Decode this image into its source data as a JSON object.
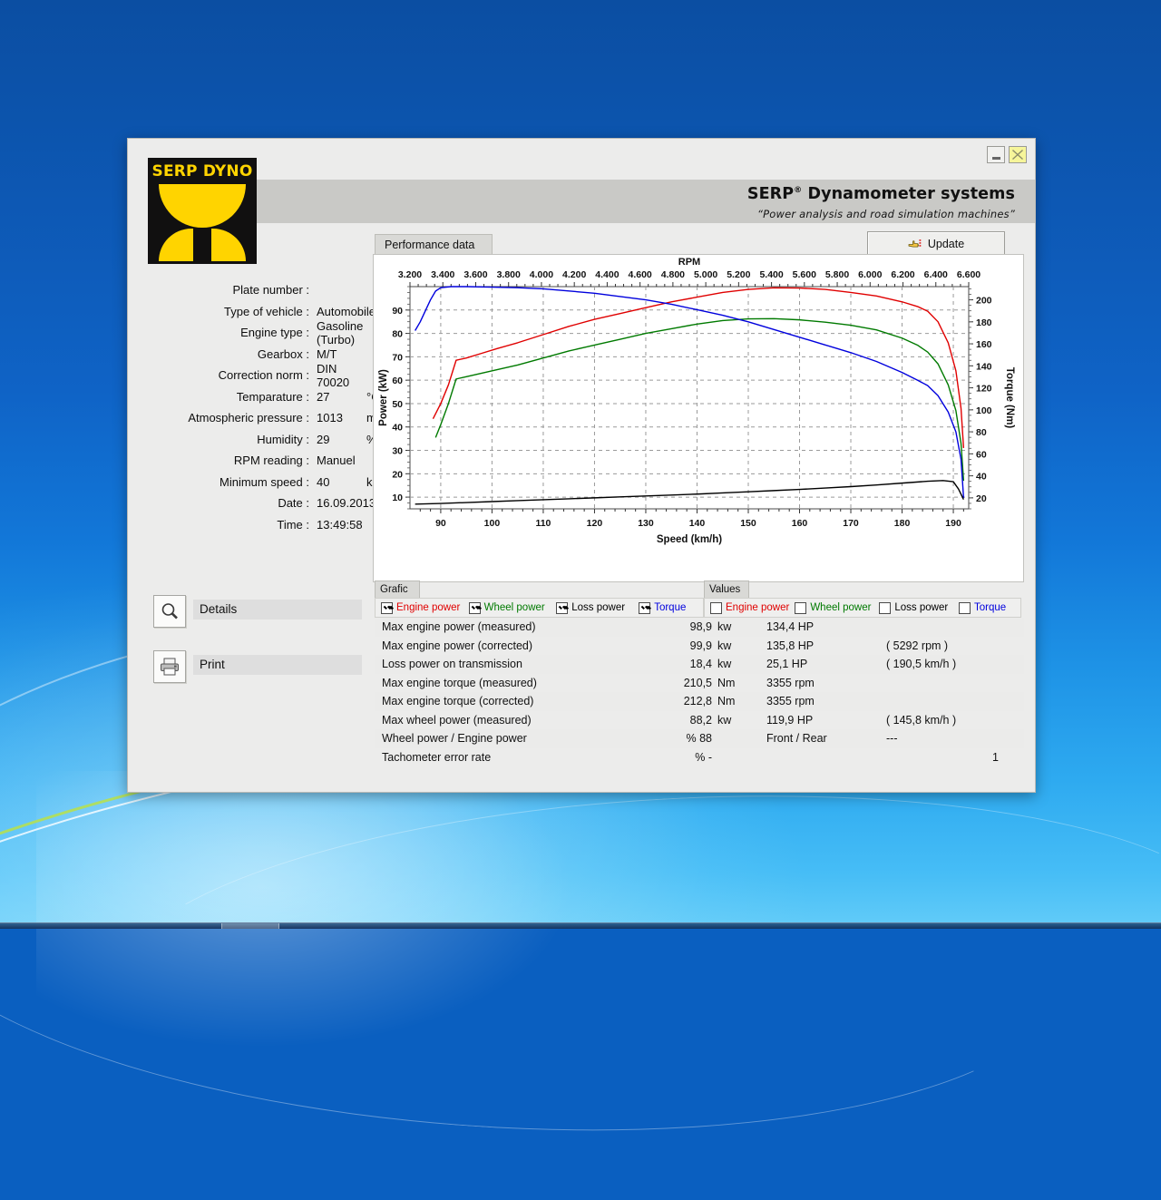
{
  "window": {
    "minimize_label": "",
    "close_label": "",
    "logo_text": "SERP DYNO",
    "brand_title": "SERP Dynamometer systems",
    "brand_trademark": "®",
    "brand_subtitle": "“Power analysis and road simulation machines”"
  },
  "info": {
    "rows": [
      {
        "label": "Plate number :",
        "value": "",
        "unit": ""
      },
      {
        "label": "Type of vehicle :",
        "value": "Automobile",
        "unit": ""
      },
      {
        "label": "Engine type :",
        "value": "Gasoline (Turbo)",
        "unit": ""
      },
      {
        "label": "Gearbox :",
        "value": "M/T",
        "unit": ""
      },
      {
        "label": "Correction norm :",
        "value": "DIN 70020",
        "unit": ""
      },
      {
        "label": "Temparature :",
        "value": "27",
        "unit": "°C"
      },
      {
        "label": "Atmospheric pressure :",
        "value": "1013",
        "unit": "mBar"
      },
      {
        "label": "Humidity :",
        "value": "29",
        "unit": "%"
      },
      {
        "label": "RPM reading :",
        "value": "Manuel",
        "unit": ""
      },
      {
        "label": "Minimum speed :",
        "value": "40",
        "unit": "km/h"
      },
      {
        "label": "Date :",
        "value": "16.09.2013",
        "unit": ""
      },
      {
        "label": "Time :",
        "value": "13:49:58",
        "unit": ""
      }
    ]
  },
  "sidebuttons": {
    "details_label": "Details",
    "print_label": "Print"
  },
  "toolbar": {
    "tab_performance_data": "Performance data",
    "update_label": "Update"
  },
  "tabs": {
    "grafic_label": "Grafic",
    "values_label": "Values"
  },
  "checkboxes": {
    "grafic": [
      {
        "label": "Engine power",
        "color": "#e00000",
        "checked": true
      },
      {
        "label": "Wheel power",
        "color": "#007a00",
        "checked": true
      },
      {
        "label": "Loss power",
        "color": "#000000",
        "checked": true
      },
      {
        "label": "Torque",
        "color": "#0000dd",
        "checked": true
      }
    ],
    "values": [
      {
        "label": "Engine power",
        "color": "#e00000",
        "checked": false
      },
      {
        "label": "Wheel power",
        "color": "#007a00",
        "checked": false
      },
      {
        "label": "Loss power",
        "color": "#000000",
        "checked": false
      },
      {
        "label": "Torque",
        "color": "#0000dd",
        "checked": false
      }
    ]
  },
  "results": {
    "rows": [
      {
        "name": "Max engine power (measured)",
        "value": "98,9",
        "unit": "kw",
        "hp": "134,4 HP",
        "note": ""
      },
      {
        "name": "Max engine power (corrected)",
        "value": "99,9",
        "unit": "kw",
        "hp": "135,8 HP",
        "note": "( 5292 rpm )"
      },
      {
        "name": "Loss power on transmission",
        "value": "18,4",
        "unit": "kw",
        "hp": "25,1 HP",
        "note": "( 190,5 km/h )"
      },
      {
        "name": "Max engine torque (measured)",
        "value": "210,5",
        "unit": "Nm",
        "hp": "3355 rpm",
        "note": ""
      },
      {
        "name": "Max engine torque (corrected)",
        "value": "212,8",
        "unit": "Nm",
        "hp": "3355 rpm",
        "note": ""
      },
      {
        "name": "Max wheel power (measured)",
        "value": "88,2",
        "unit": "kw",
        "hp": "119,9 HP",
        "note": "( 145,8 km/h )"
      },
      {
        "name": "Wheel power / Engine power",
        "value": "% 88",
        "unit": "",
        "hp": "Front / Rear",
        "note": "---"
      },
      {
        "name": "Tachometer error rate",
        "value": "% -",
        "unit": "",
        "hp": "",
        "note": "1"
      }
    ]
  },
  "chart_data": {
    "type": "line",
    "title": "",
    "xlabel": "Speed (km/h)",
    "ylabel": "Power (kW)",
    "y2label": "Torque (Nm)",
    "top_axis_label": "RPM",
    "grid": true,
    "legend": "none",
    "xlim": [
      84,
      193
    ],
    "ylim": [
      5,
      100
    ],
    "y2lim": [
      10,
      212
    ],
    "xticks": [
      90,
      100,
      110,
      120,
      130,
      140,
      150,
      160,
      170,
      180,
      190
    ],
    "yticks": [
      10,
      20,
      30,
      40,
      50,
      60,
      70,
      80,
      90
    ],
    "y2ticks": [
      20,
      40,
      60,
      80,
      100,
      120,
      140,
      160,
      180,
      200
    ],
    "top_ticks": [
      "3.200",
      "3.400",
      "3.600",
      "3.800",
      "4.000",
      "4.200",
      "4.400",
      "4.600",
      "4.800",
      "5.000",
      "5.200",
      "5.400",
      "5.600",
      "5.800",
      "6.000",
      "6.200",
      "6.400",
      "6.600"
    ],
    "top_tick_rpm": [
      3200,
      3400,
      3600,
      3800,
      4000,
      4200,
      4400,
      4600,
      4800,
      5000,
      5200,
      5400,
      5600,
      5800,
      6000,
      6200,
      6400,
      6600
    ],
    "series": [
      {
        "name": "Engine power",
        "color": "#e00000",
        "axis": "left",
        "unit": "kW",
        "x": [
          88.5,
          90,
          91.5,
          93,
          95,
          98,
          101,
          105,
          110,
          115,
          120,
          125,
          130,
          135,
          140,
          145,
          150,
          155,
          160,
          165,
          170,
          175,
          180,
          183,
          185,
          187,
          189,
          190.5,
          191.5,
          192
        ],
        "y": [
          43.5,
          50,
          58,
          68.5,
          69.5,
          71.5,
          73.5,
          76,
          79.5,
          83,
          86,
          88.5,
          91,
          93.5,
          95.5,
          97.5,
          98.8,
          99.5,
          99.4,
          98.8,
          97.5,
          96,
          93.5,
          91.5,
          89.5,
          85,
          76,
          64,
          48,
          31
        ]
      },
      {
        "name": "Wheel power",
        "color": "#007a00",
        "axis": "left",
        "unit": "kW",
        "x": [
          89,
          90,
          91.5,
          93,
          95,
          98,
          101,
          105,
          110,
          115,
          120,
          125,
          130,
          135,
          140,
          145,
          150,
          155,
          160,
          165,
          170,
          175,
          180,
          183,
          185,
          187,
          189,
          190.5,
          191.5,
          192
        ],
        "y": [
          35.5,
          41,
          50,
          60.5,
          61.5,
          63,
          64.5,
          66.5,
          69.5,
          72.5,
          75,
          77.5,
          80,
          82,
          84,
          85.5,
          86.2,
          86.3,
          85.8,
          84.8,
          83.5,
          81.5,
          78,
          75,
          72,
          67,
          58,
          47,
          33,
          17
        ]
      },
      {
        "name": "Torque",
        "color": "#0000dd",
        "axis": "right",
        "unit": "Nm",
        "x": [
          85,
          86,
          87,
          88,
          89,
          90,
          92,
          95,
          100,
          105,
          110,
          115,
          120,
          125,
          130,
          135,
          140,
          145,
          150,
          155,
          160,
          165,
          170,
          175,
          180,
          183,
          185,
          187,
          189,
          190.5,
          191.5,
          192
        ],
        "y": [
          172,
          180,
          190,
          200,
          208,
          211,
          212,
          212,
          211.5,
          211,
          210,
          208,
          206,
          203,
          200,
          196,
          191,
          186,
          180,
          173,
          166,
          159,
          152,
          144,
          134,
          127,
          122,
          113,
          98,
          80,
          55,
          20
        ]
      },
      {
        "name": "Loss power",
        "color": "#000000",
        "axis": "left",
        "unit": "kW",
        "x": [
          85,
          90,
          95,
          100,
          105,
          110,
          115,
          120,
          125,
          130,
          135,
          140,
          145,
          150,
          155,
          160,
          165,
          170,
          175,
          180,
          185,
          188,
          190,
          191,
          192
        ],
        "y": [
          7.0,
          7.3,
          7.7,
          8.1,
          8.5,
          8.9,
          9.3,
          9.7,
          10.1,
          10.5,
          10.9,
          11.3,
          11.8,
          12.3,
          12.8,
          13.3,
          13.9,
          14.5,
          15.2,
          16.0,
          16.8,
          17.1,
          16.6,
          13.5,
          9.0
        ]
      }
    ]
  }
}
